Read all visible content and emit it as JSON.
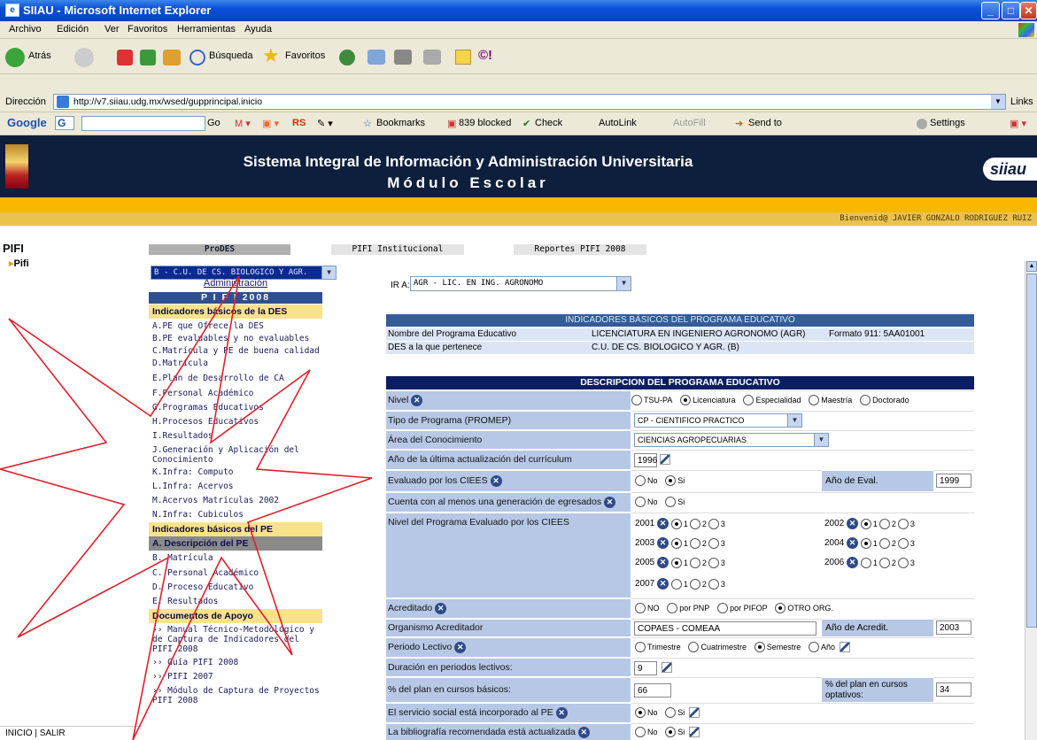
{
  "window": {
    "title": "SIIAU - Microsoft Internet Explorer"
  },
  "menu": [
    "Archivo",
    "Edición",
    "Ver",
    "Favoritos",
    "Herramientas",
    "Ayuda"
  ],
  "toolbar": {
    "back": "Atrás",
    "search": "Búsqueda",
    "favorites": "Favoritos"
  },
  "address": {
    "label": "Dirección",
    "url": "http://v7.siiau.udg.mx/wsed/gupprincipal.inicio",
    "links": "Links"
  },
  "google": {
    "label": "Google",
    "go": "Go",
    "bookmarks": "Bookmarks",
    "blocked": "839 blocked",
    "check": "Check",
    "autolink": "AutoLink",
    "autofill": "AutoFill",
    "sendto": "Send to",
    "settings": "Settings",
    "rs": "RS"
  },
  "banner": {
    "line1": "Sistema Integral de Información y Administración Universitaria",
    "line2": "Módulo Escolar",
    "logo": "siiau"
  },
  "welcome": "Bienvenid@ JAVIER GONZALO RODRIGUEZ RUIZ",
  "left": {
    "title": "PIFI",
    "item": "Pifi",
    "footer": "INICIO | SALIR"
  },
  "tabs": {
    "prodes": "ProDES",
    "institucional": "PIFI Institucional",
    "reportes": "Reportes PIFI 2008"
  },
  "des_select": "B - C.U. DE CS. BIOLOGICO Y AGR.",
  "sidemenu": {
    "admin": "Administración",
    "year": "P I F I   2008",
    "h1": "Indicadores básicos de la DES",
    "des_items": [
      "A.PE que Ofrece la DES",
      "B.PE evaluables y no evaluables",
      "C.Matrícula y PE de buena calidad",
      "D.Matrícula",
      "E.Plan de Desarrollo de CA",
      "F.Personal Académico",
      "G.Programas Educativos",
      "H.Procesos Educativos",
      "I.Resultados",
      "J.Generación y Aplicación del Conocimiento",
      "K.Infra: Computo",
      "L.Infra: Acervos",
      "M.Acervos Matrículas 2002",
      "N.Infra: Cubiculos"
    ],
    "h2": "Indicadores básicos del PE",
    "pe_items": [
      "A. Descripción del PE",
      "B. Matrícula",
      "C. Personal Académico",
      "D. Proceso Educativo",
      "E. Resultados"
    ],
    "h3": "Documentos de Apoyo",
    "doc_items": [
      "›› Manual Técnico-Metodológico y de Captura de Indicadores del PIFI 2008",
      "›› Guía PIFI 2008",
      "›› PIFI 2007",
      "›› Módulo de Captura de Proyectos PIFI 2008"
    ]
  },
  "ira": {
    "label": "IR A:",
    "value": "AGR - LIC. EN ING. AGRONOMO"
  },
  "ib": {
    "header": "INDICADORES BÁSICOS DEL PROGRAMA EDUCATIVO",
    "name_label": "Nombre del Programa Educativo",
    "name_value": "LICENCIATURA EN INGENIERO AGRONOMO (AGR)",
    "formato": "Formato 911: 5AA01001",
    "des_label": "DES a la que pertenece",
    "des_value": "C.U. DE CS. BIOLOGICO Y AGR. (B)"
  },
  "desc": {
    "title": "DESCRIPCION DEL PROGRAMA EDUCATIVO",
    "nivel_label": "Nivel",
    "nivel_opts": [
      "TSU-PA",
      "Licenciatura",
      "Especialidad",
      "Maestría",
      "Doctorado"
    ],
    "tipo_label": "Tipo de Programa (PROMEP)",
    "tipo_value": "CP - CIENTIFICO PRACTICO",
    "area_label": "Área del Conocimiento",
    "area_value": "CIENCIAS AGROPECUARIAS",
    "anio_label": "Año de la última actualización del currículum",
    "anio_value": "1996",
    "ciees_label": "Evaluado por los CIEES",
    "eval_label": "Año de Eval.",
    "eval_value": "1999",
    "egres_label": "Cuenta con al menos una generación de egresados",
    "nivelciees_label": "Nivel del Programa Evaluado por los CIEES",
    "years": [
      "2001",
      "2002",
      "2003",
      "2004",
      "2005",
      "2006",
      "2007"
    ],
    "levels": [
      "1",
      "2",
      "3"
    ],
    "no": "No",
    "si": "Si",
    "NO": "NO",
    "acred_label": "Acreditado",
    "acred_opts": [
      "por PNP",
      "por PIFOP",
      "OTRO ORG."
    ],
    "org_label": "Organismo Acreditador",
    "org_value": "COPAES - COMEAA",
    "acredit_label": "Año de Acredit.",
    "acredit_value": "2003",
    "periodo_label": "Periodo Lectivo",
    "periodo_opts": [
      "Trimestre",
      "Cuatrimestre",
      "Semestre",
      "Año"
    ],
    "dur_label": "Duración en periodos lectivos:",
    "dur_value": "9",
    "basicos_label": "% del plan en cursos básicos:",
    "basicos_value": "66",
    "opt_label": "% del plan en cursos optativos:",
    "opt_value": "34",
    "servicio_label": "El servicio social está incorporado al PE",
    "biblio_label": "La bibliografía recomendada está actualizada"
  }
}
